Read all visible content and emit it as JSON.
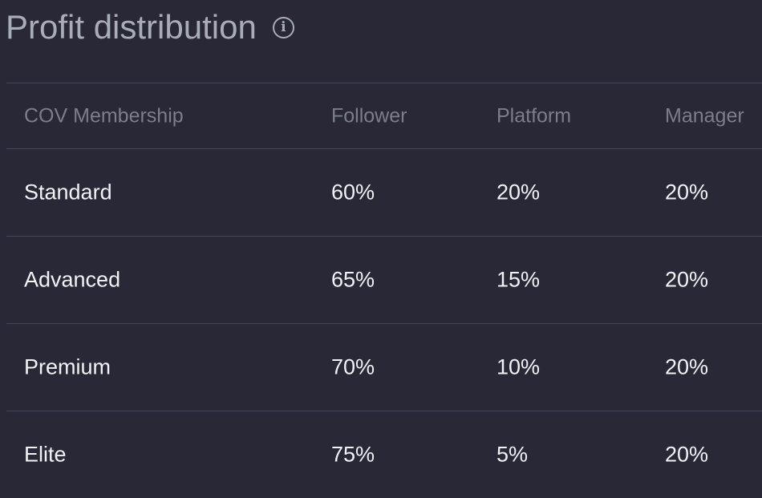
{
  "title": "Profit distribution",
  "icons": {
    "info": "info-circle-icon"
  },
  "columns": [
    "COV Membership",
    "Follower",
    "Platform",
    "Manager"
  ],
  "rows": [
    [
      "Standard",
      "60%",
      "20%",
      "20%"
    ],
    [
      "Advanced",
      "65%",
      "15%",
      "20%"
    ],
    [
      "Premium",
      "70%",
      "10%",
      "20%"
    ],
    [
      "Elite",
      "75%",
      "5%",
      "20%"
    ]
  ]
}
